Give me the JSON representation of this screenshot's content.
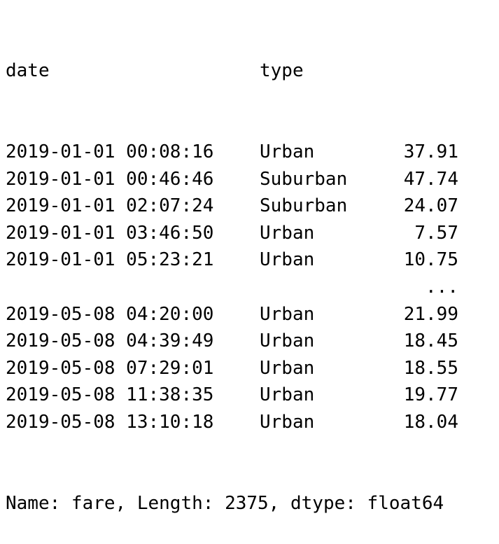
{
  "header": {
    "index_label": "date",
    "type_label": "type"
  },
  "rows": [
    {
      "date": "2019-01-01 00:08:16",
      "type": "Urban",
      "fare": "37.91"
    },
    {
      "date": "2019-01-01 00:46:46",
      "type": "Suburban",
      "fare": "47.74"
    },
    {
      "date": "2019-01-01 02:07:24",
      "type": "Suburban",
      "fare": "24.07"
    },
    {
      "date": "2019-01-01 03:46:50",
      "type": "Urban",
      "fare": "7.57"
    },
    {
      "date": "2019-01-01 05:23:21",
      "type": "Urban",
      "fare": "10.75"
    },
    {
      "date": "",
      "type": "",
      "fare": "..."
    },
    {
      "date": "2019-05-08 04:20:00",
      "type": "Urban",
      "fare": "21.99"
    },
    {
      "date": "2019-05-08 04:39:49",
      "type": "Urban",
      "fare": "18.45"
    },
    {
      "date": "2019-05-08 07:29:01",
      "type": "Urban",
      "fare": "18.55"
    },
    {
      "date": "2019-05-08 11:38:35",
      "type": "Urban",
      "fare": "19.77"
    },
    {
      "date": "2019-05-08 13:10:18",
      "type": "Urban",
      "fare": "18.04"
    }
  ],
  "footer": "Name: fare, Length: 2375, dtype: float64"
}
